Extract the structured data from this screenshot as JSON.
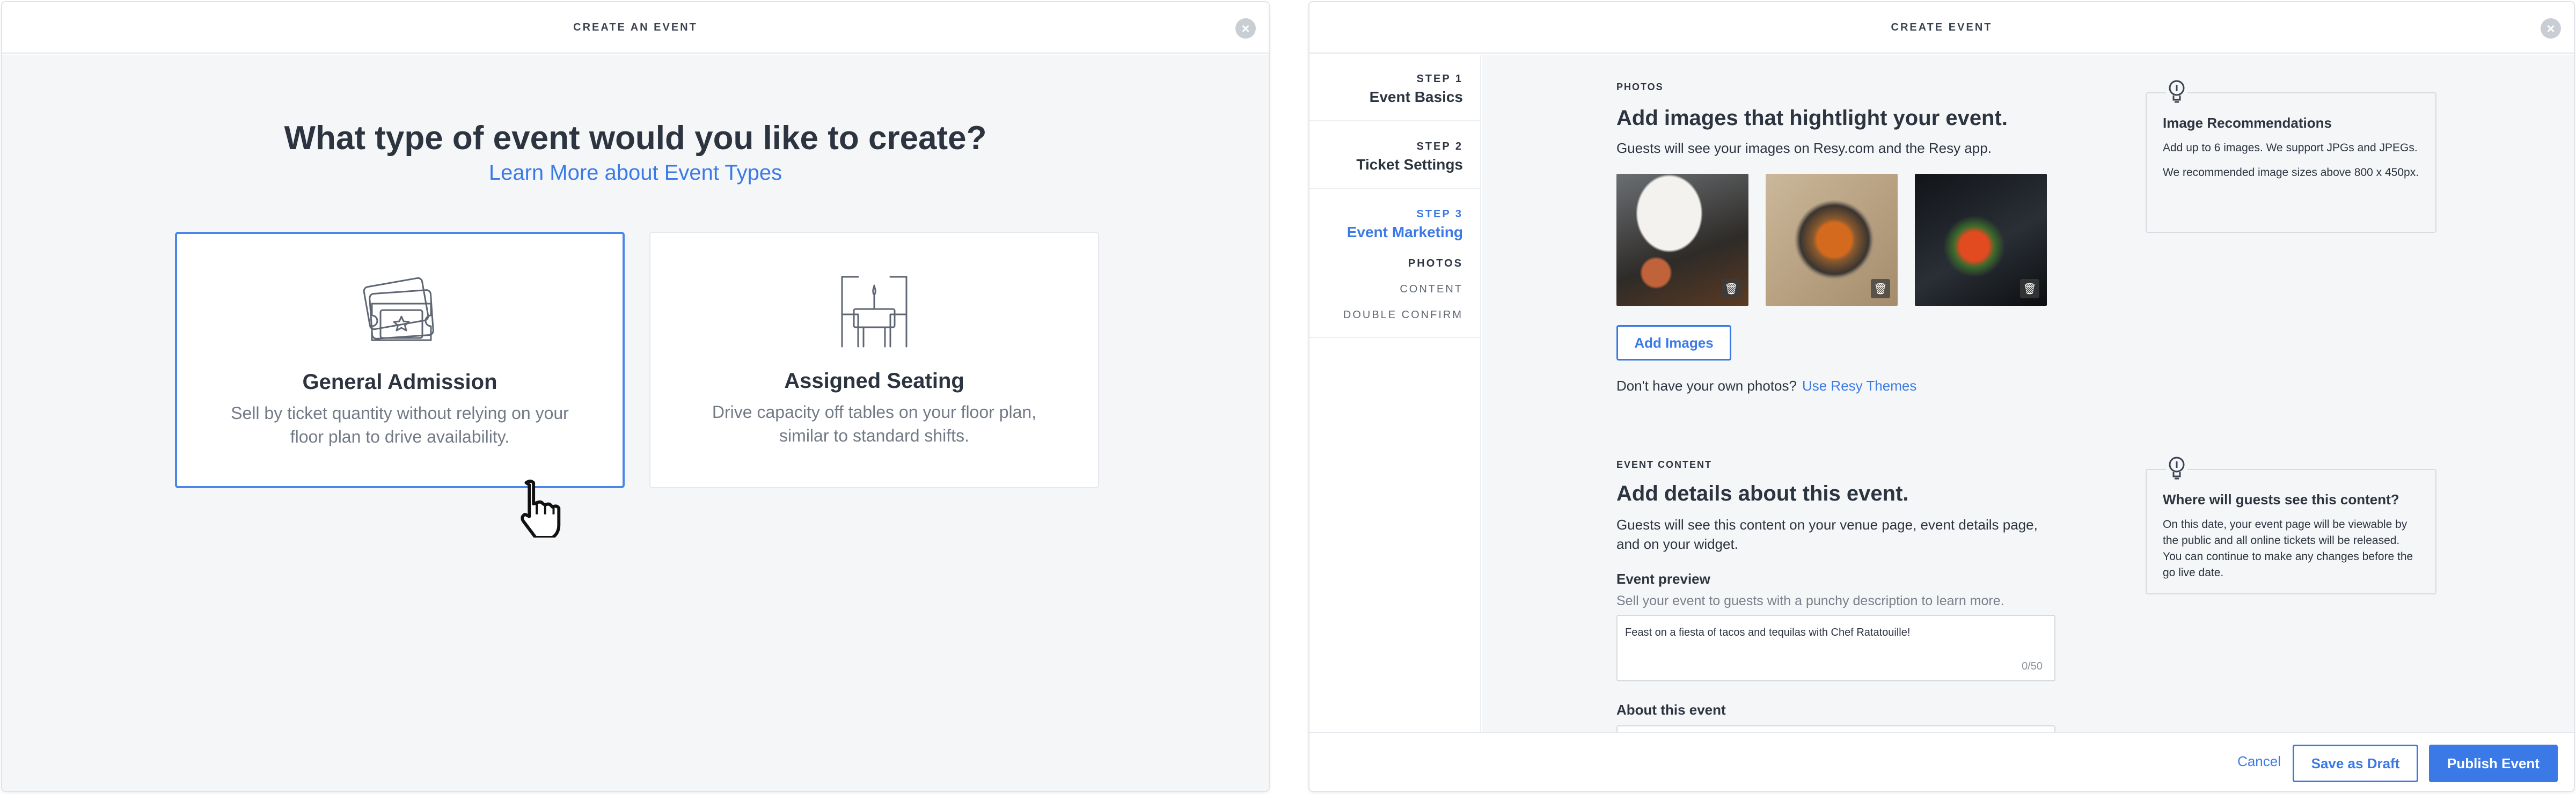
{
  "left_modal": {
    "title": "CREATE AN EVENT",
    "close_glyph": "×",
    "headline": "What type of event would you like to create?",
    "learn_more": "Learn More about Event Types",
    "cards": [
      {
        "title": "General Admission",
        "description": "Sell by ticket quantity without relying on your floor plan to drive availability.",
        "icon": "ticket-icon",
        "selected": true
      },
      {
        "title": "Assigned Seating",
        "description": "Drive capacity off tables on your floor plan, similar to standard shifts.",
        "icon": "table-chairs-icon",
        "selected": false
      }
    ]
  },
  "right_modal": {
    "title": "CREATE EVENT",
    "close_glyph": "×",
    "steps": [
      {
        "num": "STEP 1",
        "name": "Event Basics"
      },
      {
        "num": "STEP 2",
        "name": "Ticket Settings"
      },
      {
        "num": "STEP 3",
        "name": "Event Marketing"
      }
    ],
    "sub_steps": [
      "PHOTOS",
      "CONTENT",
      "DOUBLE CONFIRM"
    ],
    "photos": {
      "label": "PHOTOS",
      "title": "Add images that hightlight your event.",
      "subtitle": "Guests will see your images on Resy.com and the Resy app.",
      "add_button": "Add Images",
      "no_photos": "Don't have your own photos?",
      "themes_link": "Use Resy Themes"
    },
    "image_tip": {
      "title": "Image Recommendations",
      "text1": "Add up to 6 images. We support JPGs and JPEGs.",
      "text2": "We recommended image sizes above 800 x 450px."
    },
    "content": {
      "label": "EVENT CONTENT",
      "title": "Add details about this event.",
      "subtitle": "Guests will see this content on your venue page, event details page, and on your widget.",
      "preview_label": "Event preview",
      "preview_help": "Sell your event to guests with a punchy description to learn more.",
      "preview_value": "Feast on a fiesta of tacos and tequilas with Chef Ratatouille!",
      "preview_count": "0/50",
      "about_label": "About this event"
    },
    "content_tip": {
      "title": "Where will guests see this content?",
      "text": "On this date, your event page will be viewable by the public and all online tickets will be released. You can continue to make any changes before the go live date."
    },
    "footer": {
      "cancel": "Cancel",
      "draft": "Save as Draft",
      "publish": "Publish Event"
    }
  },
  "colors": {
    "accent": "#3b7ae6",
    "text": "#2c3440",
    "muted": "#727a86",
    "background": "#f5f6f8"
  }
}
